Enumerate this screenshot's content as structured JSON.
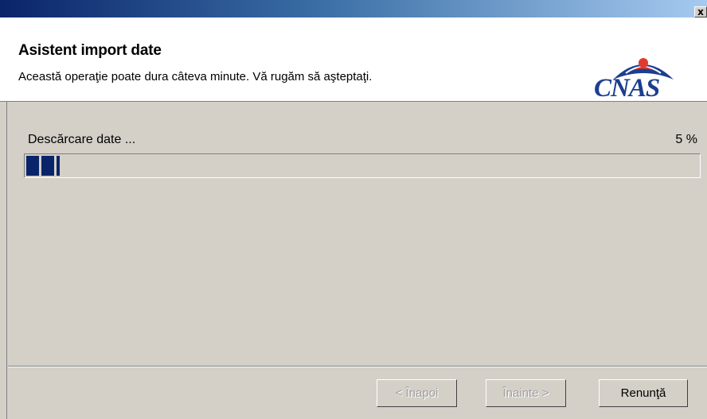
{
  "window": {
    "close_glyph": "x"
  },
  "header": {
    "title": "Asistent import date",
    "subtitle": "Această operaţie poate dura câteva minute. Vă rugăm să aşteptaţi.",
    "logo_text": "CNAS"
  },
  "progress": {
    "label": "Descărcare date ...",
    "percent_text": "5 %",
    "value": 0.05
  },
  "buttons": {
    "back": "< Înapoi",
    "next": "Înainte >",
    "cancel": "Renunţă"
  },
  "colors": {
    "accent": "#0a246a",
    "logo": "#1d3e8f",
    "logo_red": "#e03a2f"
  },
  "icons": {
    "close": "close-icon",
    "logo": "cnas-logo"
  }
}
